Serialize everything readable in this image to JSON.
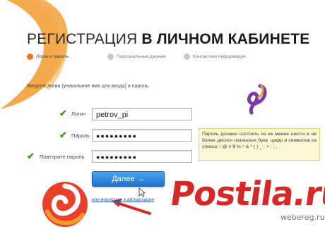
{
  "title": {
    "regular": "РЕГИСТРАЦИЯ ",
    "bold": "В ЛИЧНОМ КАБИНЕТЕ"
  },
  "steps": [
    {
      "label": "Логин и пароль",
      "active": true
    },
    {
      "label": "Персональные данные",
      "active": false
    },
    {
      "label": "Контактная информация",
      "active": false
    }
  ],
  "intro": "Введите логин (уникальное имя для входа) и пароль.",
  "form": {
    "login_label": "Логин",
    "login_value": "petrov_pi",
    "password_label": "Пароль",
    "password_value": "●●●●●●●●●",
    "confirm_label": "Повторите пароль",
    "confirm_value": "●●●●●●●●●"
  },
  "tooltip": "Пароль должен состоять из не менее шести и не более десяти латинских букв, цифр и символов из списка: ! @ # $ % ^ & * ( ) _ - + : ; , .",
  "next_button": "Далее →",
  "back_link": "или вернуться к авторизации",
  "watermark": {
    "main": "Postila.ru",
    "sub": "webereg.ru"
  },
  "colors": {
    "accent": "#e87722",
    "button": "#1e74cc",
    "check": "#3b9a1f",
    "watermark": "#d62828"
  }
}
